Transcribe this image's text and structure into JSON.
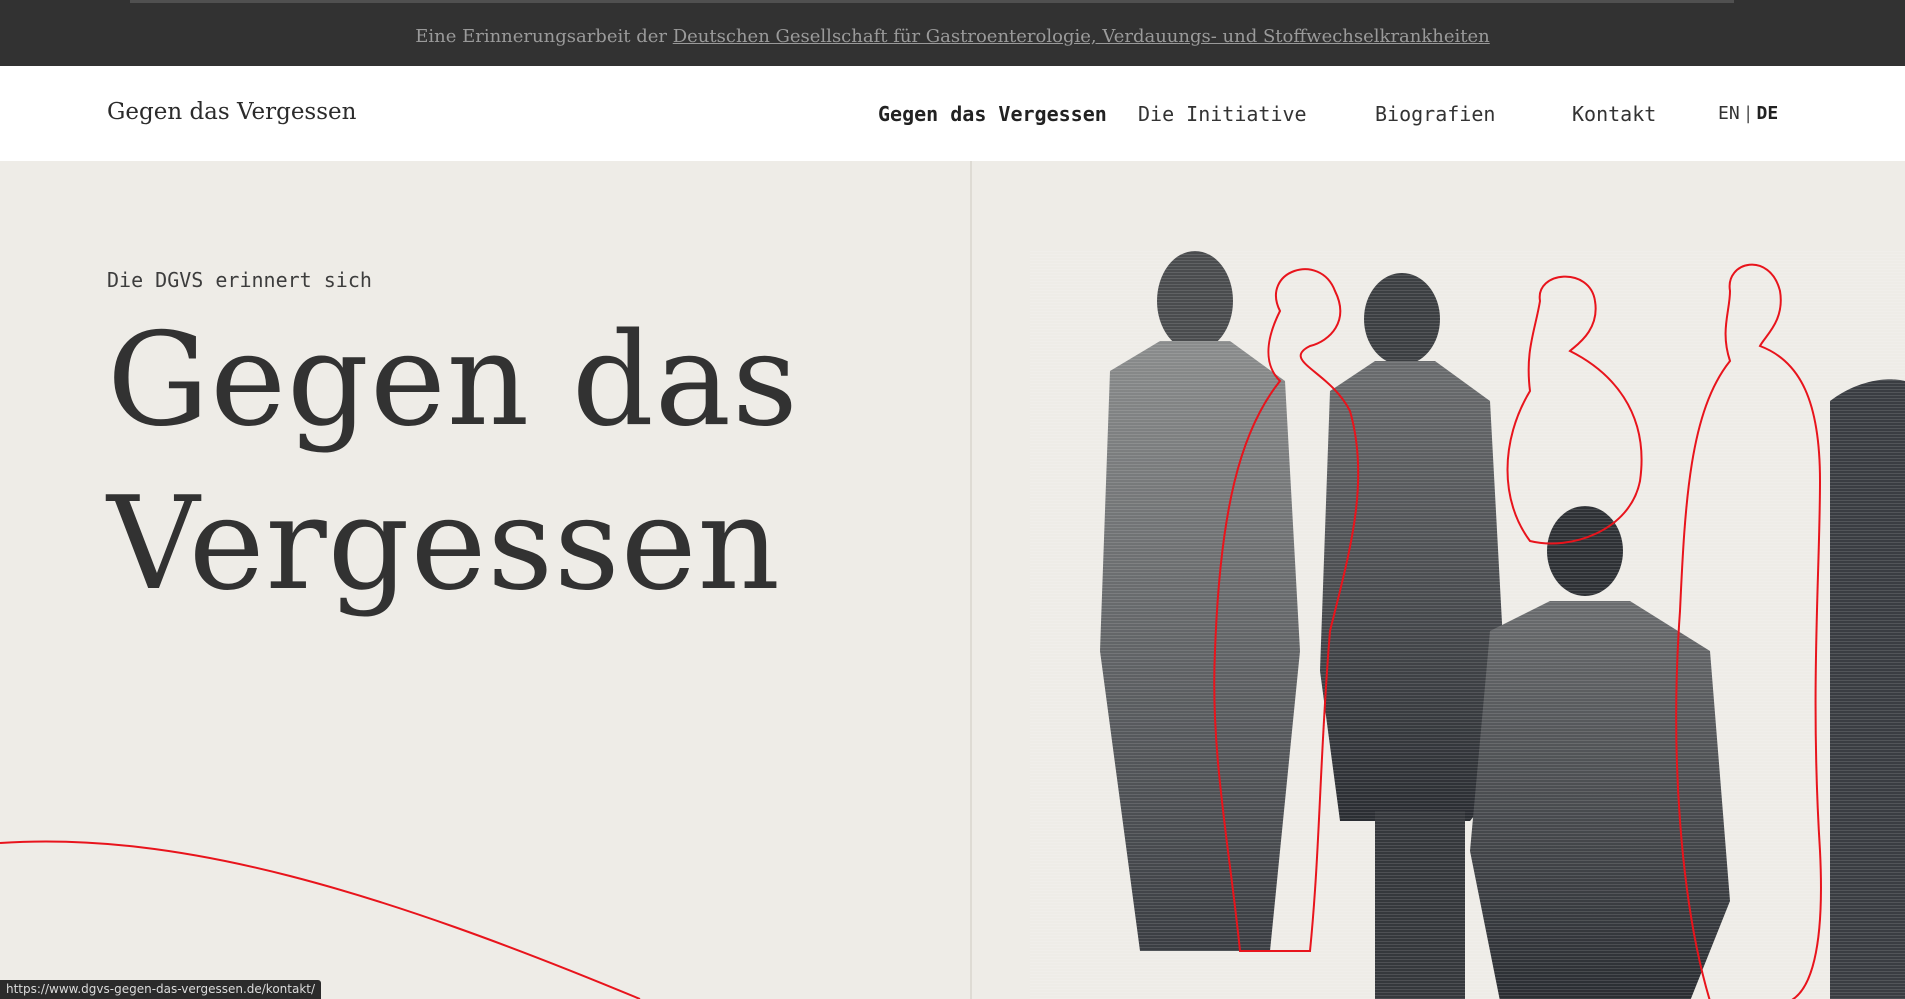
{
  "topbar": {
    "prefix": "Eine Erinnerungsarbeit der",
    "link_text": "Deutschen Gesellschaft für Gastroenterologie, Verdauungs- und Stoffwechselkrankheiten"
  },
  "header": {
    "brand": "Gegen das Vergessen",
    "nav": [
      {
        "label": "Gegen das Vergessen",
        "active": true
      },
      {
        "label": "Die Initiative",
        "active": false
      },
      {
        "label": "Biografien",
        "active": false
      },
      {
        "label": "Kontakt",
        "active": false
      }
    ],
    "lang": {
      "en": "EN",
      "separator": "|",
      "de": "DE",
      "active": "DE"
    }
  },
  "hero": {
    "kicker": "Die DGVS erinnert sich",
    "headline_line1": "Gegen das",
    "headline_line2": "Vergessen"
  },
  "status_bar": {
    "url": "https://www.dgvs-gegen-das-vergessen.de/kontakt/"
  },
  "colors": {
    "topbar_bg": "#323232",
    "hero_bg": "#eeece7",
    "accent_red": "#e8141c",
    "text_dark": "#323232"
  }
}
